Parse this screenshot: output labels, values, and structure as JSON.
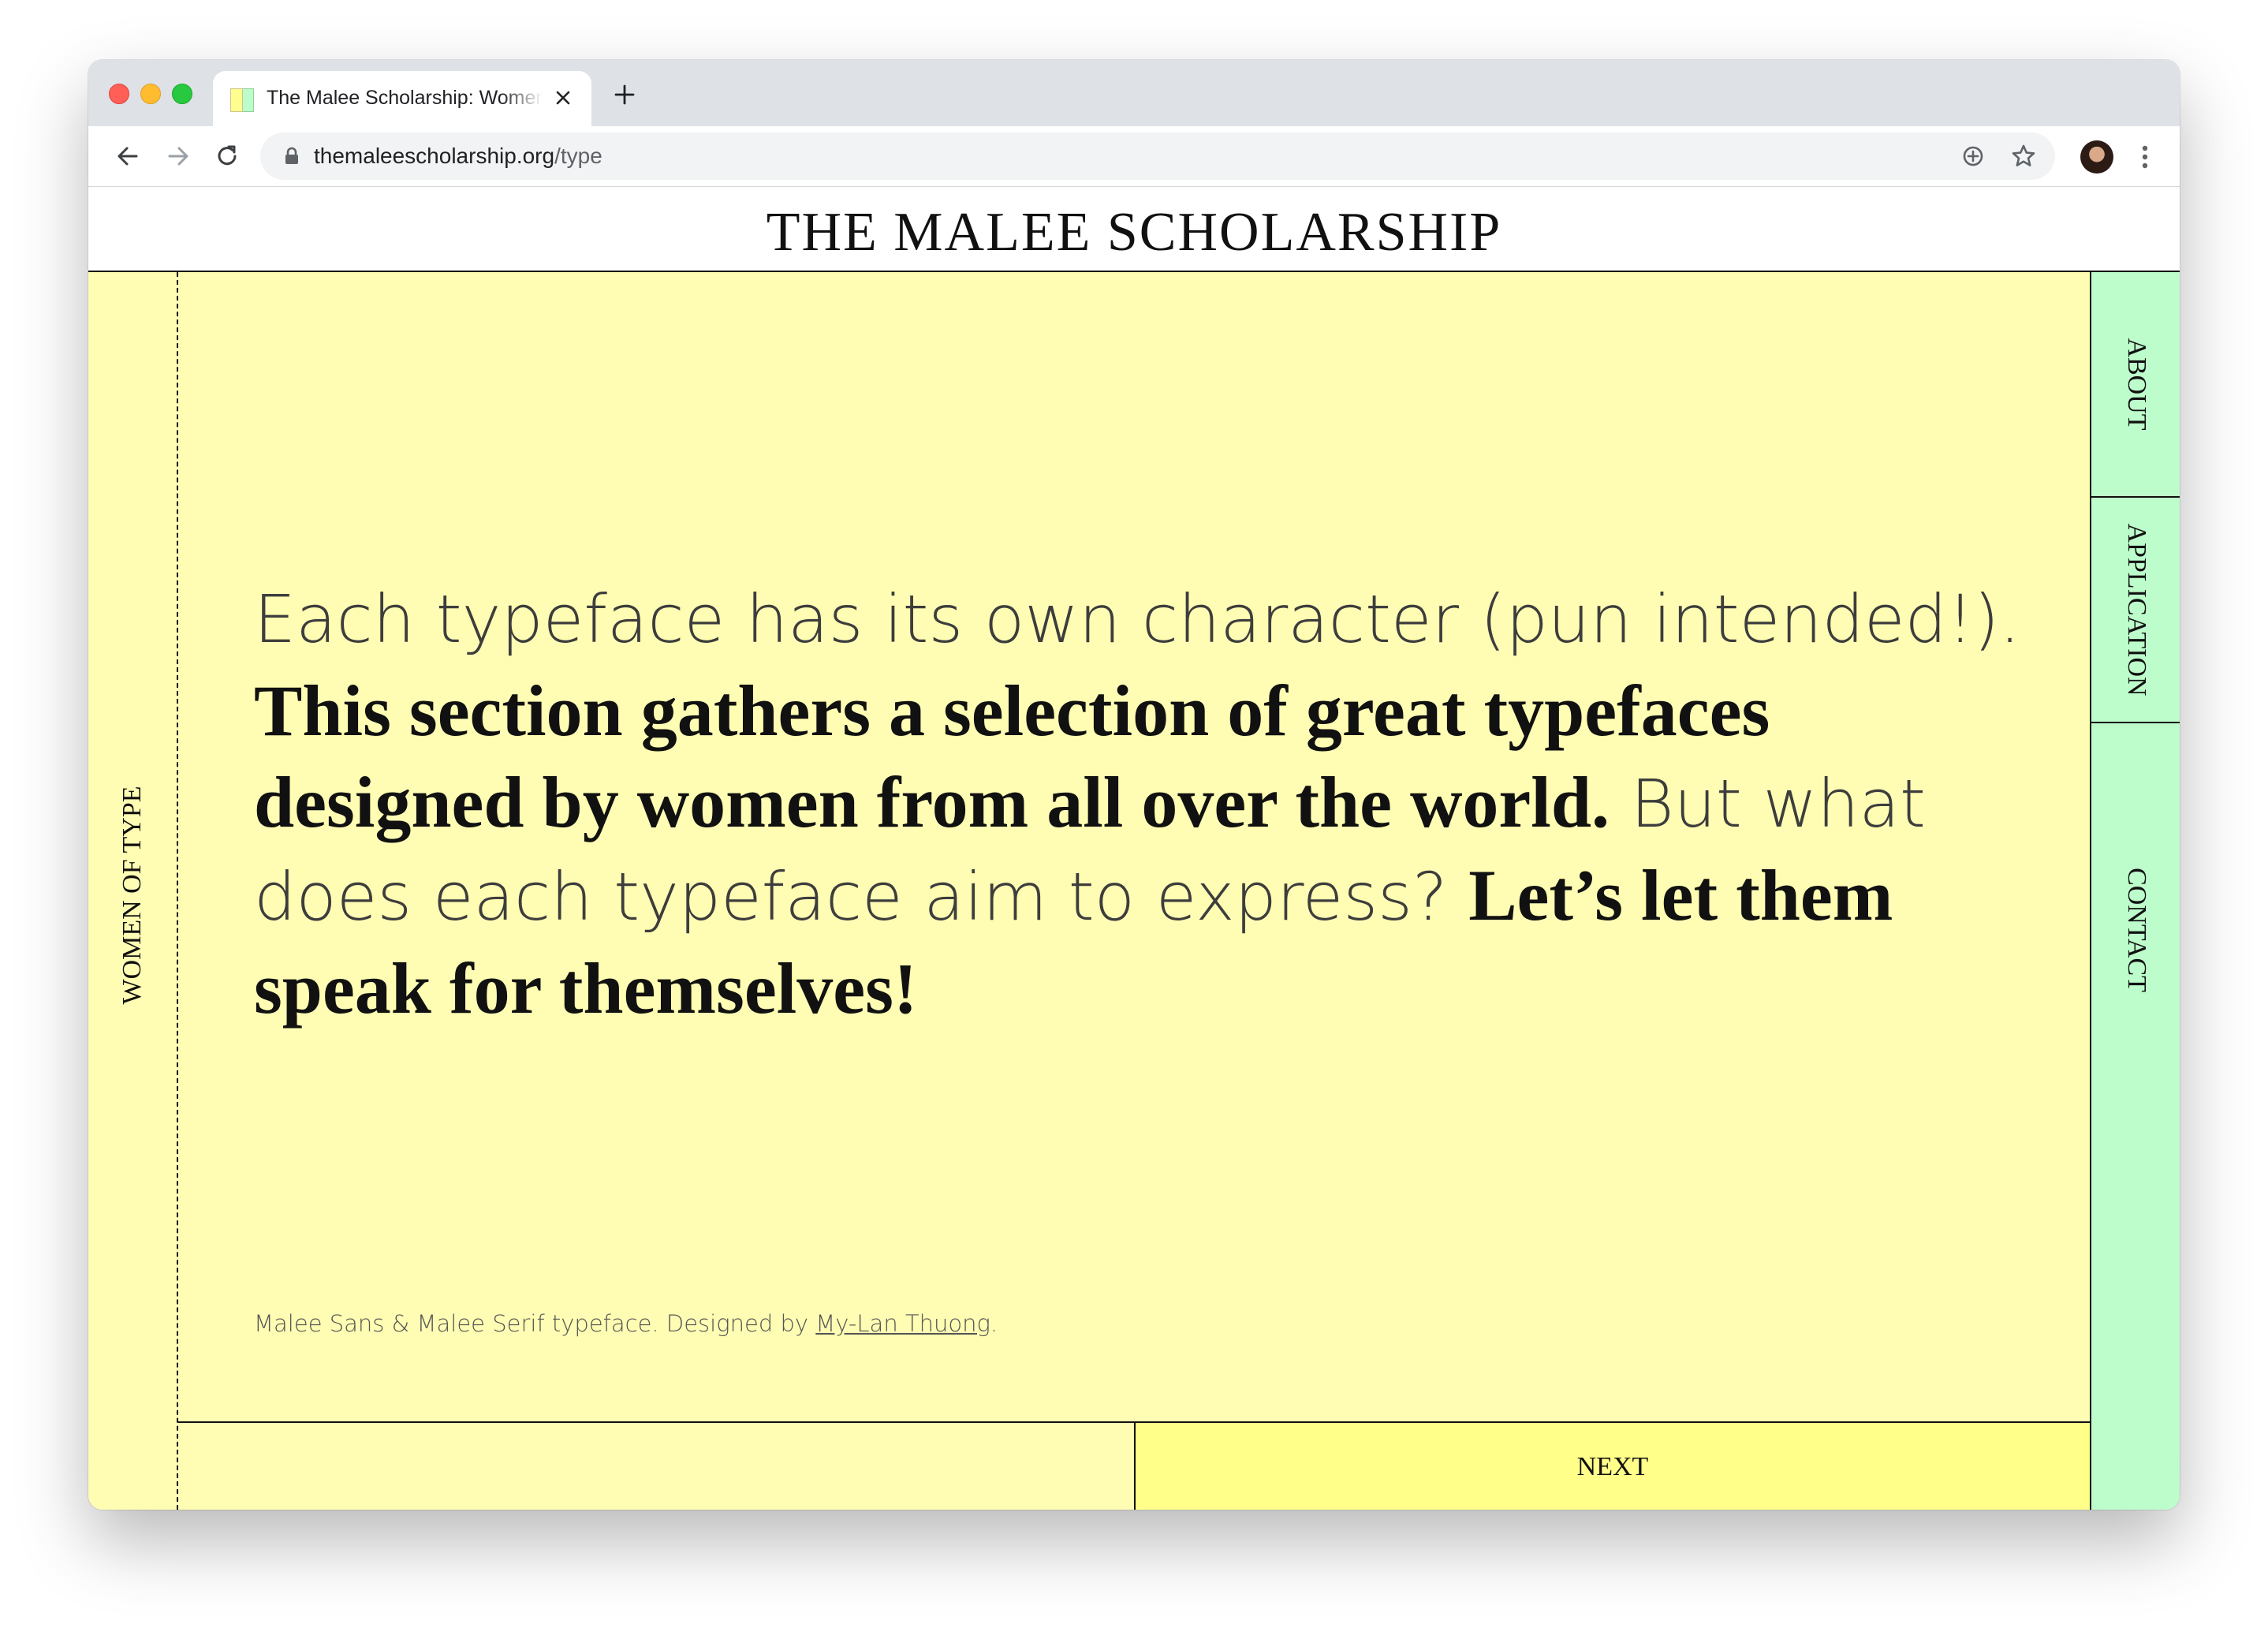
{
  "browser": {
    "tab_title": "The Malee Scholarship: Women of Type",
    "url_host": "themaleescholarship.org",
    "url_path": "/type",
    "favicon_colors": [
      "#fffdb3",
      "#bdfccb"
    ]
  },
  "site": {
    "title": "THE MALEE SCHOLARSHIP",
    "section_label": "WOMEN OF TYPE",
    "nav": {
      "about": "ABOUT",
      "application": "APPLICATION",
      "contact": "CONTACT"
    },
    "next_label": "NEXT"
  },
  "intro": {
    "part1": "Each typeface has its own character (pun intended!). ",
    "part2": "This section gathers a selection of great typefaces designed by women from all over the world.",
    "part3": " But what does each typeface aim to express? ",
    "part4": "Let’s let them speak for themselves!"
  },
  "credit": {
    "prefix": "Malee Sans & Malee Serif typeface. Designed by ",
    "designer": "My-Lan Thuong",
    "suffix": "."
  },
  "colors": {
    "page_bg": "#fffdb3",
    "nav_bg": "#bdfccb",
    "next_bg": "#ffff8a"
  },
  "icons": {
    "back": "arrow-left-icon",
    "forward": "arrow-right-icon",
    "reload": "reload-icon",
    "lock": "lock-icon",
    "install": "install-plus-icon",
    "bookmark": "star-icon",
    "menu": "three-dots-icon"
  }
}
